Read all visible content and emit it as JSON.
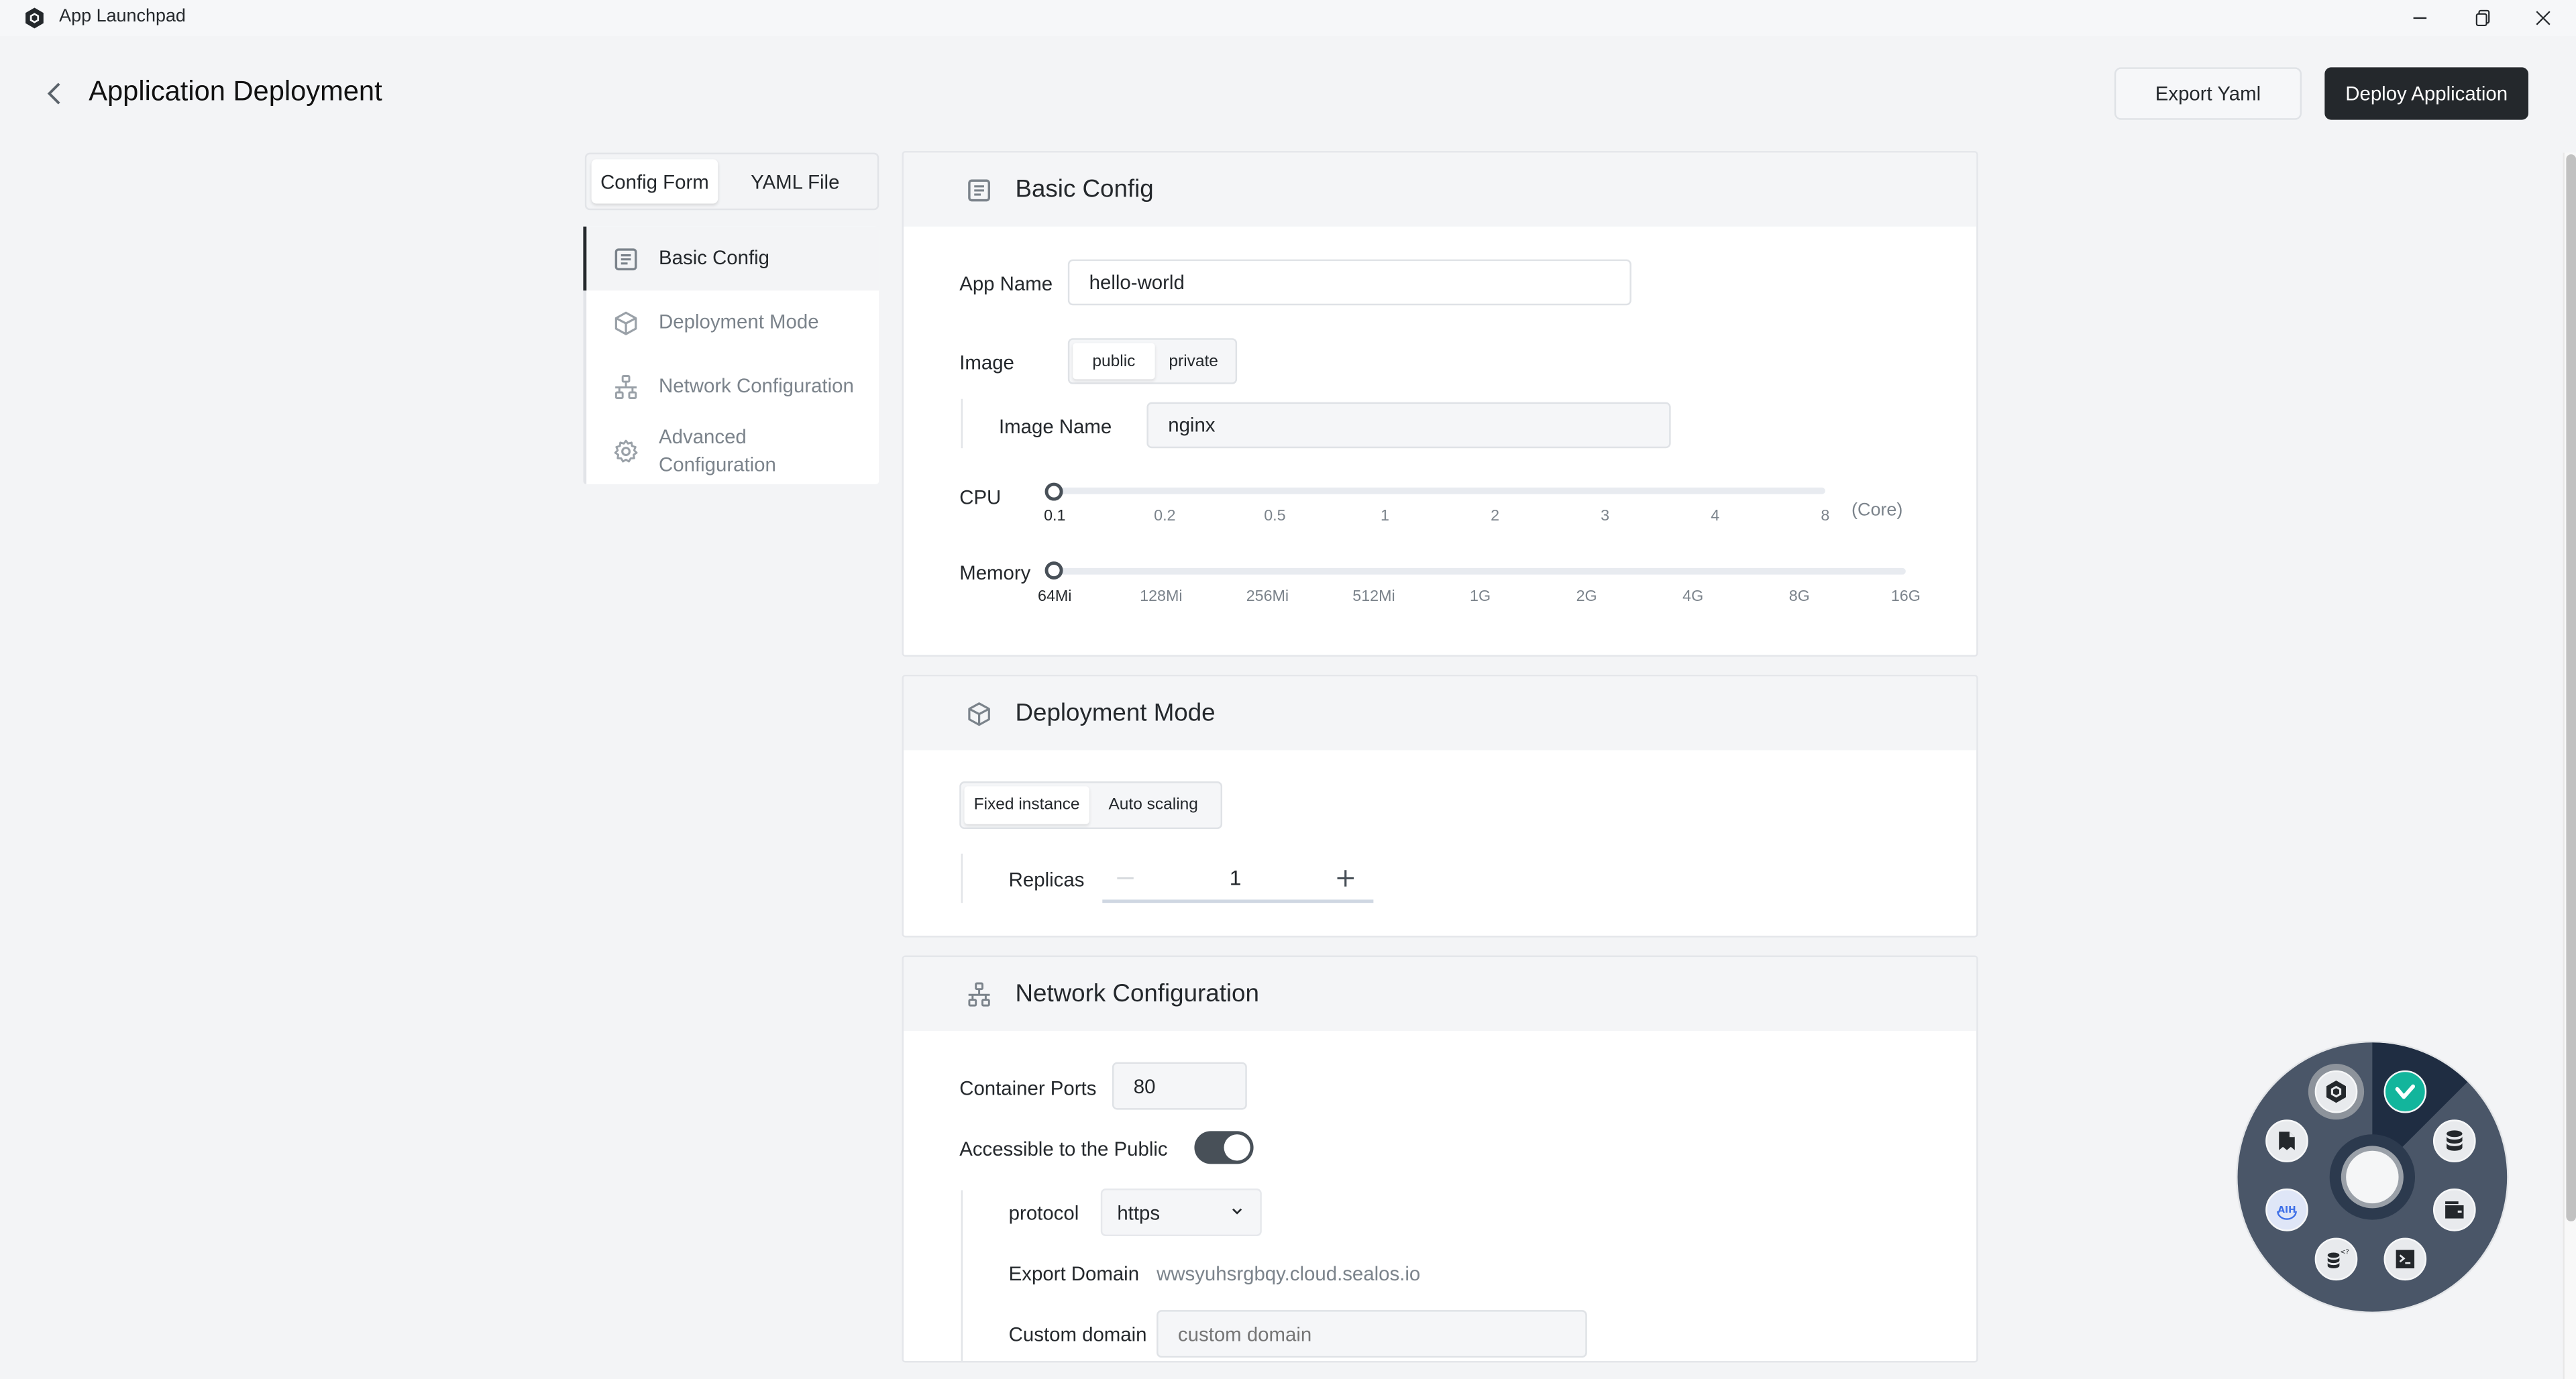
{
  "window": {
    "title": "App Launchpad",
    "controls": {
      "minimize": "minimize",
      "restore": "restore",
      "close": "close"
    }
  },
  "header": {
    "title": "Application Deployment",
    "export_label": "Export Yaml",
    "deploy_label": "Deploy Application"
  },
  "tabs": [
    {
      "label": "Config Form",
      "active": true
    },
    {
      "label": "YAML File",
      "active": false
    }
  ],
  "nav": {
    "items": [
      {
        "label": "Basic Config",
        "icon": "document-icon",
        "active": true
      },
      {
        "label": "Deployment Mode",
        "icon": "cube-icon",
        "active": false
      },
      {
        "label": "Network Configuration",
        "icon": "network-icon",
        "active": false
      },
      {
        "label": "Advanced Configuration",
        "icon": "gear-icon",
        "active": false
      }
    ]
  },
  "basic": {
    "title": "Basic Config",
    "app_name_label": "App Name",
    "app_name_value": "hello-world",
    "image_label": "Image",
    "image_options": [
      "public",
      "private"
    ],
    "image_selected": "public",
    "image_name_label": "Image Name",
    "image_name_value": "nginx",
    "cpu": {
      "label": "CPU",
      "ticks": [
        "0.1",
        "0.2",
        "0.5",
        "1",
        "2",
        "3",
        "4",
        "8"
      ],
      "selected": "0.1",
      "unit": "(Core)"
    },
    "memory": {
      "label": "Memory",
      "ticks": [
        "64Mi",
        "128Mi",
        "256Mi",
        "512Mi",
        "1G",
        "2G",
        "4G",
        "8G",
        "16G"
      ],
      "selected": "64Mi"
    }
  },
  "deployment": {
    "title": "Deployment Mode",
    "modes": [
      "Fixed instance",
      "Auto scaling"
    ],
    "mode_selected": "Fixed instance",
    "replicas_label": "Replicas",
    "replicas_value": "1",
    "minus": "−",
    "plus": "+"
  },
  "network": {
    "title": "Network Configuration",
    "container_ports_label": "Container Ports",
    "container_ports_value": "80",
    "public_label": "Accessible to the Public",
    "public_enabled": true,
    "protocol_label": "protocol",
    "protocol_value": "https",
    "export_domain_label": "Export Domain",
    "export_domain_value": "wwsyuhsrgbqy.cloud.sealos.io",
    "custom_domain_label": "Custom domain",
    "custom_domain_placeholder": "custom domain",
    "custom_domain_value": ""
  },
  "launcher": {
    "apps": [
      {
        "name": "app-launchpad",
        "icon": "hexagon-gem-icon"
      },
      {
        "name": "vscode-like-app",
        "icon": "teal-v-icon",
        "accent": "#13b59c"
      },
      {
        "name": "database",
        "icon": "database-icon"
      },
      {
        "name": "cost-center",
        "icon": "wallet-icon"
      },
      {
        "name": "terminal",
        "icon": "terminal-icon"
      },
      {
        "name": "db-query",
        "icon": "database-code-icon"
      },
      {
        "name": "aiha",
        "icon": "aiha-logo-icon",
        "accent": "#3d6fe8"
      },
      {
        "name": "docs",
        "icon": "bookmark-doc-icon"
      }
    ]
  },
  "colors": {
    "primary_dark": "#24282c",
    "muted_text": "#7b838b",
    "background": "#f3f4f6",
    "launcher_bg": "#4a5668",
    "launcher_active_wedge": "#1f2d42"
  }
}
